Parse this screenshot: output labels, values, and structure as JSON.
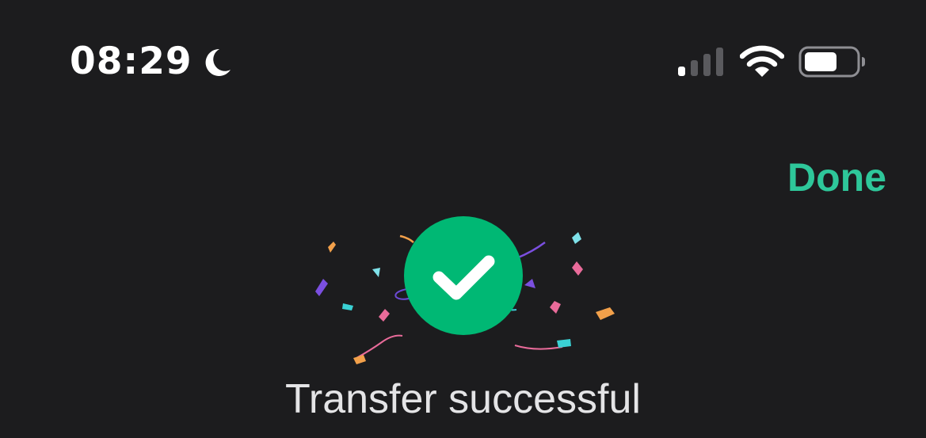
{
  "status_bar": {
    "time": "08:29",
    "focus_icon": "moon-icon",
    "signal_icon": "cellular-signal-icon",
    "wifi_icon": "wifi-icon",
    "battery_icon": "battery-icon"
  },
  "header": {
    "done_label": "Done",
    "accent_color": "#2ec79a"
  },
  "success": {
    "icon": "checkmark-circle-icon",
    "icon_color": "#00b874",
    "decoration": "confetti",
    "title": "Transfer successful"
  }
}
